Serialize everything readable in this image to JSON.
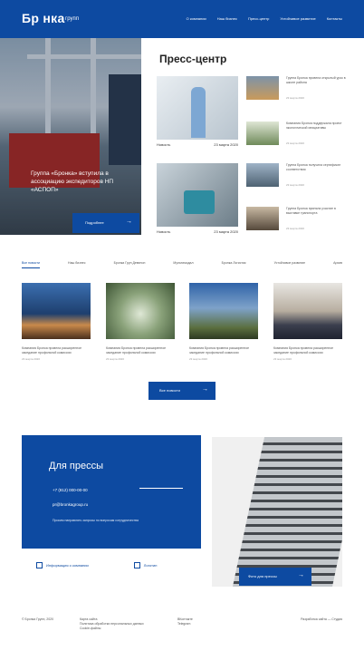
{
  "header": {
    "logo": "Бр  нка",
    "logo_sub": "групп",
    "nav": [
      "О компании",
      "Наш бизнес",
      "Пресс-центр",
      "Устойчивое развитие",
      "Контакты"
    ]
  },
  "hero": {
    "title": "Группа «Бронка» вступила в ассоциацию экспедиторов НП «АСПОП»",
    "button": "Подробнее"
  },
  "press": {
    "title": "Пресс-центр",
    "features": [
      {
        "label": "Новость",
        "date": "23 марта 2020"
      },
      {
        "label": "Новость",
        "date": "23 марта 2020"
      }
    ],
    "small_news": [
      {
        "text": "Группа Бронка провела открытый урок в школе района",
        "date": "23 марта 2020"
      },
      {
        "text": "Компания Бронка поддержала проект экологической инициативы",
        "date": "23 марта 2020"
      },
      {
        "text": "Группа Бронка получила сертификат соответствия",
        "date": "23 марта 2020"
      },
      {
        "text": "Группа Бронка приняла участие в выставке транспорта",
        "date": "23 марта 2020"
      }
    ]
  },
  "filters": [
    "Все новости",
    "Наш бизнес",
    "Бронка Груп Девелоп",
    "Мультимодал",
    "Бронка Логистик",
    "Устойчивое развитие",
    "Архив"
  ],
  "cards": [
    {
      "text": "Компания Бронка провела расширенное заседание профильной комиссии",
      "date": "23 марта 2020"
    },
    {
      "text": "Компания Бронка провела расширенное заседание профильной комиссии",
      "date": "23 марта 2020"
    },
    {
      "text": "Компания Бронка провела расширенное заседание профильной комиссии",
      "date": "23 марта 2020"
    },
    {
      "text": "Компания Бронка провела расширенное заседание профильной комиссии",
      "date": "23 марта 2020"
    }
  ],
  "more_button": "Все новости",
  "for_press": {
    "title": "Для прессы",
    "phone": "+7 (812) 000-00-00",
    "email": "pr@bronkagroup.ru",
    "note": "Просим направлять запросы по вопросам сотрудничества"
  },
  "building_button": "Фото для прессы",
  "links": [
    "Информация о компании",
    "Логотип"
  ],
  "footer": {
    "col1": [
      "© Бронка Групп, 2020"
    ],
    "col2": [
      "Карта сайта",
      "Политика обработки персональных данных",
      "Cookie-файлы"
    ],
    "col3": [
      "ВКонтакте",
      "Telegram"
    ],
    "right": "Разработка сайта — Студия"
  },
  "colors": {
    "brand": "#0d4aa1"
  }
}
